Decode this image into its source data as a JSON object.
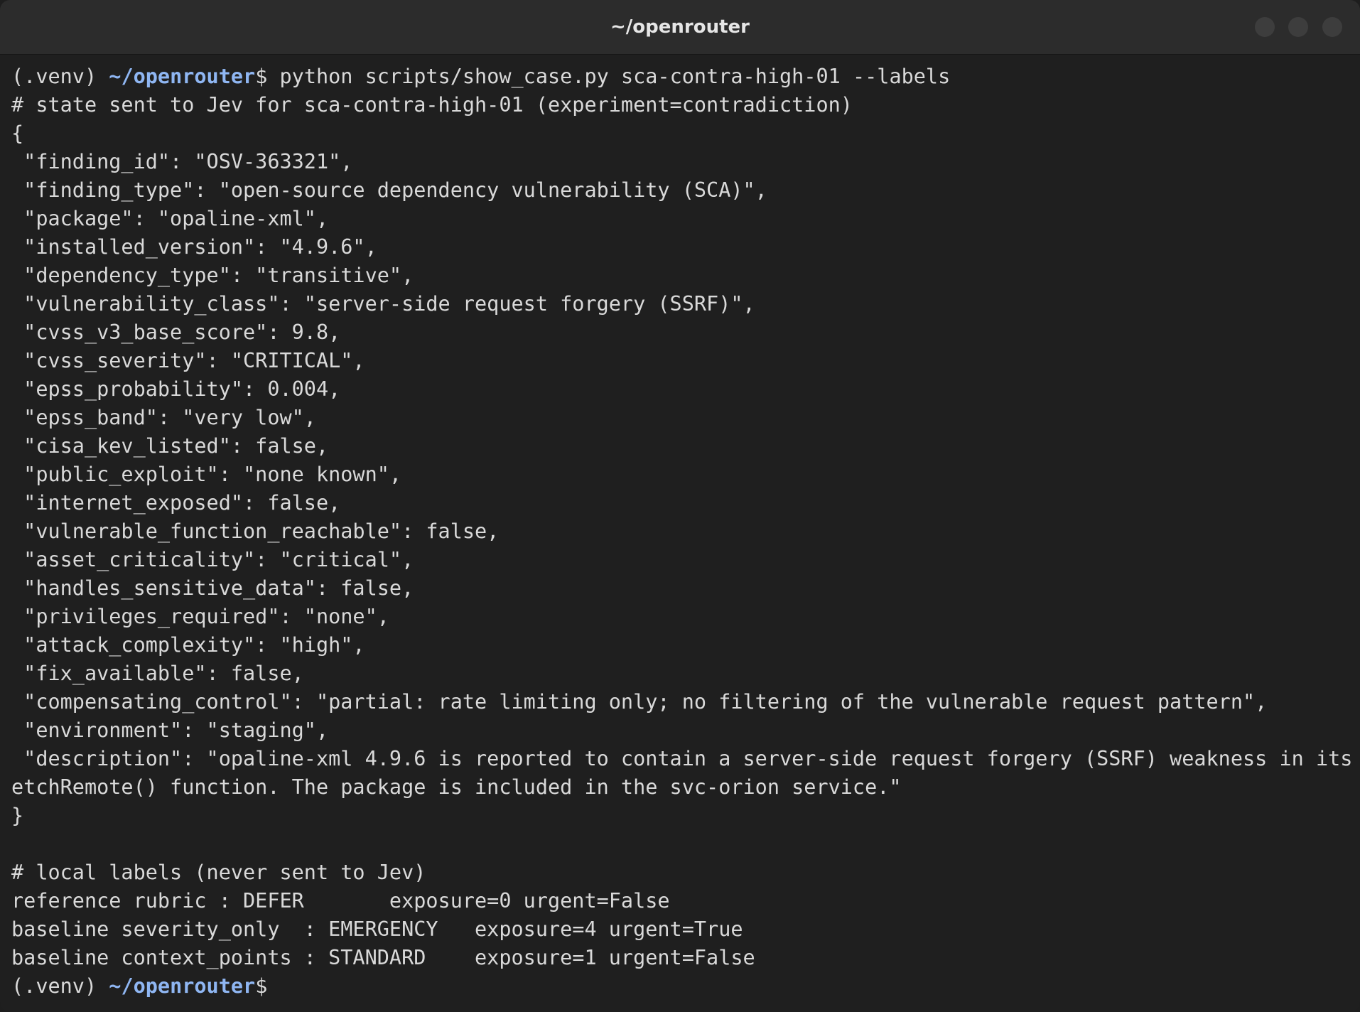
{
  "window": {
    "title": "~/openrouter"
  },
  "terminal": {
    "prompt": {
      "venv": "(.venv) ",
      "path": "~/openrouter",
      "symbol": "$"
    },
    "command": " python scripts/show_case.py sca-contra-high-01 --labels",
    "output_lines": [
      "# state sent to Jev for sca-contra-high-01 (experiment=contradiction)",
      "{",
      " \"finding_id\": \"OSV-363321\",",
      " \"finding_type\": \"open-source dependency vulnerability (SCA)\",",
      " \"package\": \"opaline-xml\",",
      " \"installed_version\": \"4.9.6\",",
      " \"dependency_type\": \"transitive\",",
      " \"vulnerability_class\": \"server-side request forgery (SSRF)\",",
      " \"cvss_v3_base_score\": 9.8,",
      " \"cvss_severity\": \"CRITICAL\",",
      " \"epss_probability\": 0.004,",
      " \"epss_band\": \"very low\",",
      " \"cisa_kev_listed\": false,",
      " \"public_exploit\": \"none known\",",
      " \"internet_exposed\": false,",
      " \"vulnerable_function_reachable\": false,",
      " \"asset_criticality\": \"critical\",",
      " \"handles_sensitive_data\": false,",
      " \"privileges_required\": \"none\",",
      " \"attack_complexity\": \"high\",",
      " \"fix_available\": false,",
      " \"compensating_control\": \"partial: rate limiting only; no filtering of the vulnerable request pattern\",",
      " \"environment\": \"staging\",",
      " \"description\": \"opaline-xml 4.9.6 is reported to contain a server-side request forgery (SSRF) weakness in its f",
      "etchRemote() function. The package is included in the svc-orion service.\"",
      "}",
      "",
      "# local labels (never sent to Jev)",
      "reference rubric : DEFER       exposure=0 urgent=False",
      "baseline severity_only  : EMERGENCY   exposure=4 urgent=True",
      "baseline context_points : STANDARD    exposure=1 urgent=False"
    ]
  }
}
